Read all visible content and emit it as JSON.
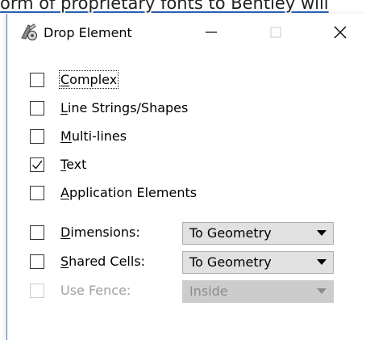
{
  "background": {
    "text": "orm of proprietary fonts to Bentley will"
  },
  "window": {
    "title": "Drop Element",
    "minimize_glyph": "—",
    "maximize_glyph": "□",
    "close_glyph": "✕"
  },
  "options": [
    {
      "id": "complex",
      "mnemonic": "C",
      "rest": "omplex",
      "checked": false,
      "enabled": true
    },
    {
      "id": "line-strings",
      "mnemonic": "L",
      "rest": "ine Strings/Shapes",
      "checked": false,
      "enabled": true
    },
    {
      "id": "multi-lines",
      "mnemonic": "M",
      "rest": "ulti-lines",
      "checked": false,
      "enabled": true
    },
    {
      "id": "text",
      "mnemonic": "T",
      "rest": "ext",
      "checked": true,
      "enabled": true
    },
    {
      "id": "application-elements",
      "mnemonic": "A",
      "rest": "pplication Elements",
      "checked": false,
      "enabled": true
    }
  ],
  "dropdown_options": [
    {
      "id": "dimensions",
      "mnemonic": "D",
      "rest": "imensions:",
      "checked": false,
      "enabled": true,
      "value": "To Geometry"
    },
    {
      "id": "shared-cells",
      "mnemonic": "S",
      "rest": "hared Cells:",
      "checked": false,
      "enabled": true,
      "value": "To Geometry"
    },
    {
      "id": "use-fence",
      "label": "Use Fence:",
      "checked": false,
      "enabled": false,
      "value": "Inside"
    }
  ],
  "colors": {
    "accent_border": "#3b7bd8",
    "disabled_text": "#a0a0a0",
    "dropdown_bg": "#e1e1e1"
  },
  "icons": {
    "app": "drop-element-icon",
    "checkmark": "check-icon",
    "dropdown_arrow": "triangle-down-icon"
  }
}
